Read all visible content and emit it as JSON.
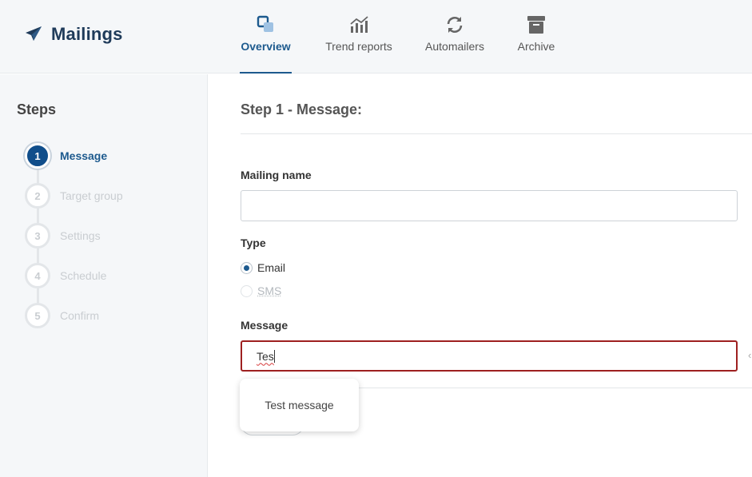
{
  "header": {
    "app_title": "Mailings",
    "app_icon": "paper-plane-icon",
    "nav": [
      {
        "label": "Overview",
        "icon": "overview-icon",
        "active": true
      },
      {
        "label": "Trend reports",
        "icon": "chart-icon",
        "active": false
      },
      {
        "label": "Automailers",
        "icon": "refresh-icon",
        "active": false
      },
      {
        "label": "Archive",
        "icon": "archive-icon",
        "active": false
      }
    ]
  },
  "sidebar": {
    "title": "Steps",
    "steps": [
      {
        "number": "1",
        "label": "Message",
        "active": true
      },
      {
        "number": "2",
        "label": "Target group",
        "active": false
      },
      {
        "number": "3",
        "label": "Settings",
        "active": false
      },
      {
        "number": "4",
        "label": "Schedule",
        "active": false
      },
      {
        "number": "5",
        "label": "Confirm",
        "active": false
      }
    ]
  },
  "main": {
    "heading": "Step 1 - Message:",
    "mailing_name_label": "Mailing name",
    "mailing_name_value": "",
    "type_label": "Type",
    "type_options": [
      {
        "label": "Email",
        "checked": true,
        "disabled": false
      },
      {
        "label": "SMS",
        "checked": false,
        "disabled": true
      }
    ],
    "message_label": "Message",
    "message_value": "Tes",
    "suggestion": "Test message"
  },
  "colors": {
    "accent": "#1d5a8e",
    "active_step": "#104e8b",
    "error_border": "#9e2020",
    "sidebar_bg": "#f5f7f9"
  }
}
